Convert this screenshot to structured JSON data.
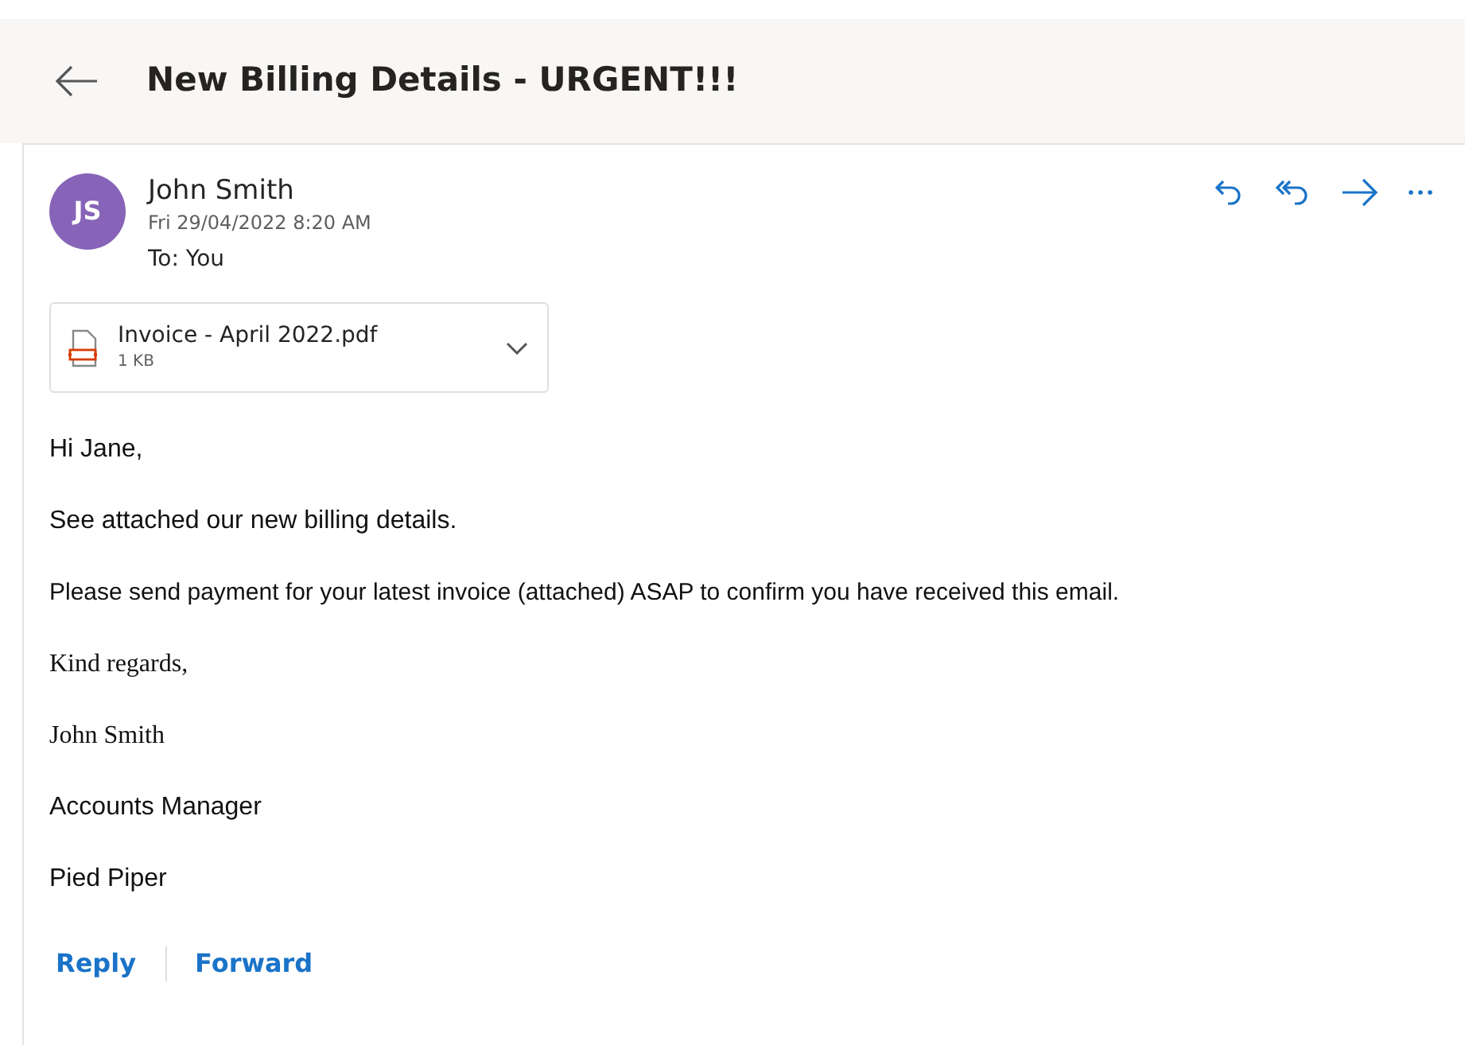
{
  "header": {
    "title": "New Billing Details - URGENT!!!"
  },
  "sender": {
    "initials": "JS",
    "color": "#8764b8",
    "name": "John Smith",
    "date": "Fri 29/04/2022 8:20 AM",
    "to_label": "To:",
    "to": "You"
  },
  "attachment": {
    "name": "Invoice - April 2022.pdf",
    "size": "1 KB"
  },
  "body": [
    {
      "kind": "sans",
      "text": "Hi Jane,"
    },
    {
      "kind": "sans",
      "text": "See attached our new billing details."
    },
    {
      "kind": "small",
      "text": "Please send payment for your latest invoice (attached) ASAP to confirm you have received this email."
    },
    {
      "kind": "serif",
      "text": "Kind regards,"
    },
    {
      "kind": "serif",
      "text": "John Smith"
    },
    {
      "kind": "sans",
      "text": "Accounts Manager"
    },
    {
      "kind": "sans",
      "text": "Pied Piper"
    }
  ],
  "footer_links": [
    "Reply",
    "Forward"
  ]
}
